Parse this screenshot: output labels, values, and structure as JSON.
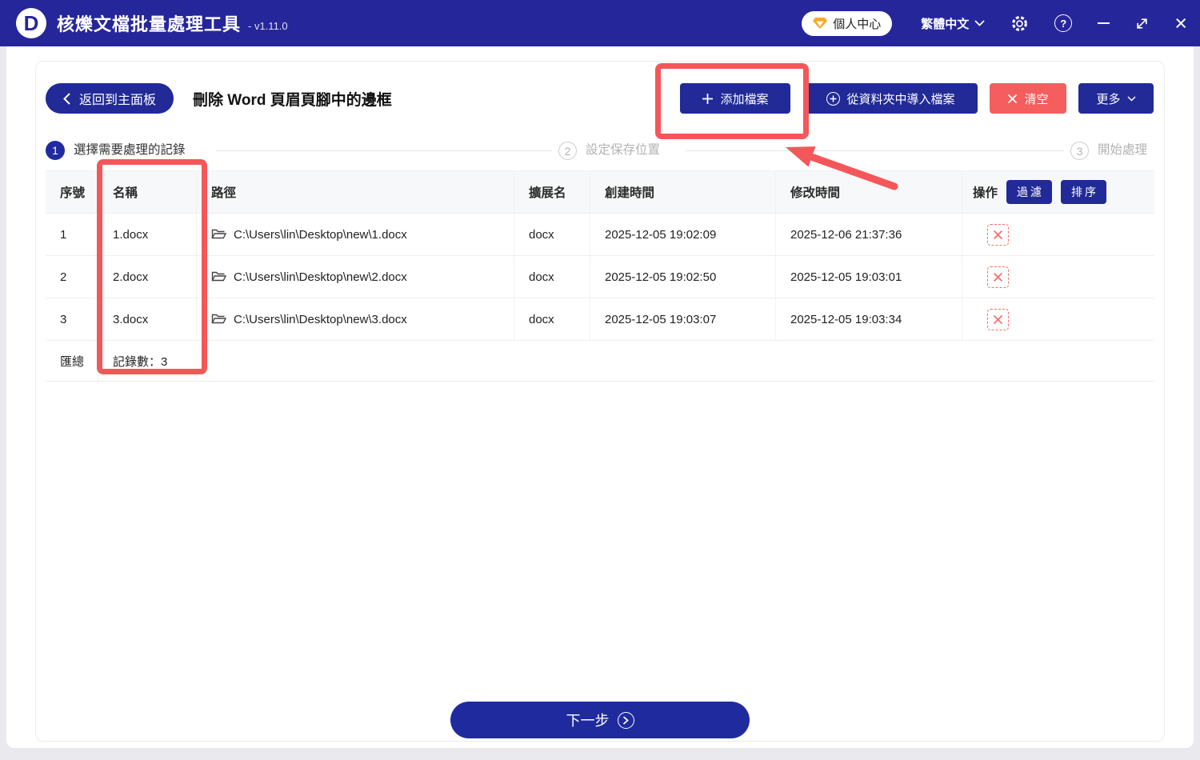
{
  "titlebar": {
    "logo_letter": "D",
    "app_title": "核爍文檔批量處理工具",
    "version": "- v1.11.0",
    "user_center_label": "個人中心",
    "language_label": "繁體中文"
  },
  "toolbar": {
    "back_label": "返回到主面板",
    "page_title": "刪除 Word 頁眉頁腳中的邊框",
    "add_files_label": "添加檔案",
    "import_folder_label": "從資料夾中導入檔案",
    "clear_label": "清空",
    "more_label": "更多"
  },
  "steps": {
    "step1_num": "1",
    "step1_label": "選擇需要處理的記錄",
    "step2_num": "2",
    "step2_label": "設定保存位置",
    "step3_num": "3",
    "step3_label": "開始處理"
  },
  "table": {
    "headers": [
      "序號",
      "名稱",
      "路徑",
      "擴展名",
      "創建時間",
      "修改時間",
      "操作"
    ],
    "filter_label": "過濾",
    "sort_label": "排序",
    "rows": [
      {
        "index": "1",
        "name": "1.docx",
        "path": "C:\\Users\\lin\\Desktop\\new\\1.docx",
        "ext": "docx",
        "created": "2025-12-05 19:02:09",
        "modified": "2025-12-06 21:37:36"
      },
      {
        "index": "2",
        "name": "2.docx",
        "path": "C:\\Users\\lin\\Desktop\\new\\2.docx",
        "ext": "docx",
        "created": "2025-12-05 19:02:50",
        "modified": "2025-12-05 19:03:01"
      },
      {
        "index": "3",
        "name": "3.docx",
        "path": "C:\\Users\\lin\\Desktop\\new\\3.docx",
        "ext": "docx",
        "created": "2025-12-05 19:03:07",
        "modified": "2025-12-05 19:03:34"
      }
    ],
    "summary_label": "匯總",
    "summary_value": "記錄數：3"
  },
  "footer": {
    "next_label": "下一步"
  },
  "colors": {
    "titlebar": "#26269b",
    "primary_button": "#212a96",
    "danger_button": "#f45e5e",
    "annotation_red": "#f4575a",
    "delete_icon_red": "#f56c6c",
    "step_active": "#202b9e"
  }
}
